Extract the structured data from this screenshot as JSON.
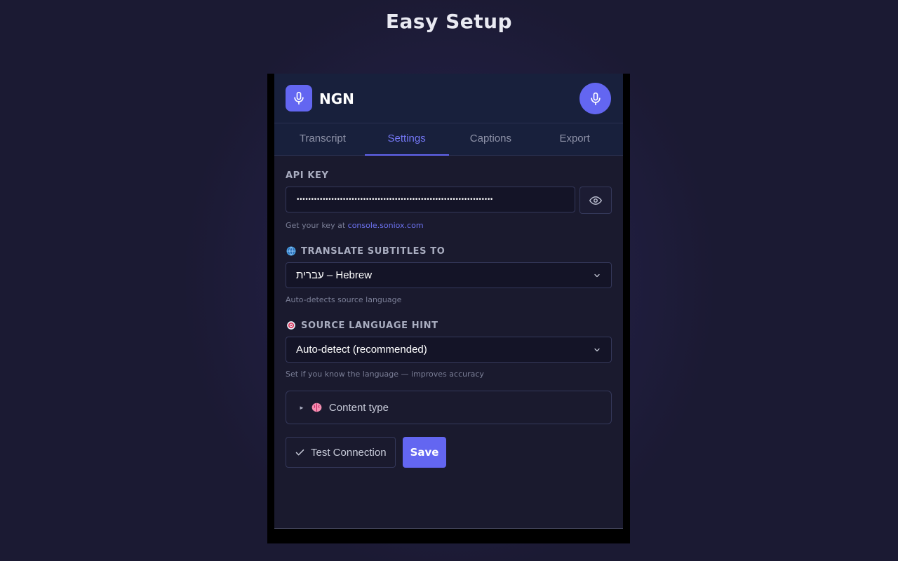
{
  "page": {
    "title": "Easy Setup"
  },
  "app": {
    "name": "NGN"
  },
  "tabs": [
    {
      "label": "Transcript",
      "active": false
    },
    {
      "label": "Settings",
      "active": true
    },
    {
      "label": "Captions",
      "active": false
    },
    {
      "label": "Export",
      "active": false
    }
  ],
  "api_key": {
    "label": "API KEY",
    "value": "••••••••••••••••••••••••••••••••••••••••••••••••••••••••••••••••••••",
    "hint_prefix": "Get your key at ",
    "hint_link": "console.soniox.com"
  },
  "translate": {
    "label": "TRANSLATE SUBTITLES TO",
    "icon": "globe-icon",
    "selected": "עברית – Hebrew",
    "hint": "Auto-detects source language"
  },
  "source": {
    "label": "SOURCE LANGUAGE HINT",
    "icon": "target-icon",
    "selected": "Auto-detect (recommended)",
    "hint": "Set if you know the language — improves accuracy"
  },
  "content_type": {
    "label": "Content type",
    "icon": "brain-icon"
  },
  "buttons": {
    "test": "Test Connection",
    "save": "Save"
  },
  "colors": {
    "accent": "#6366f1",
    "background": "#1a1a2e",
    "header": "#18203c"
  }
}
